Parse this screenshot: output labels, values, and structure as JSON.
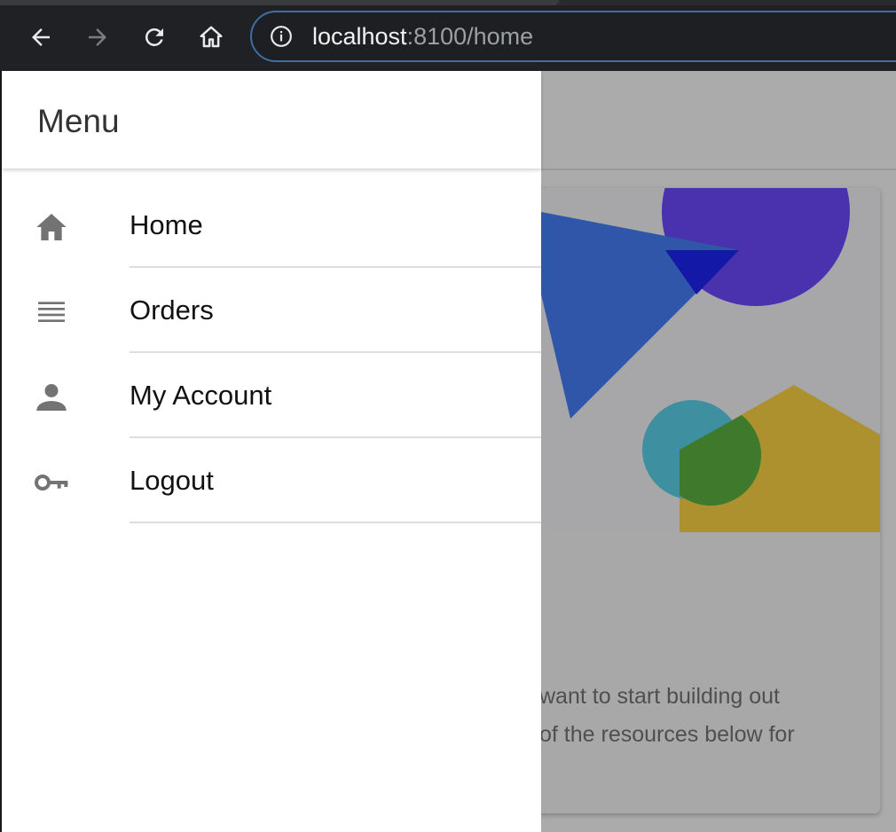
{
  "browser": {
    "url_host": "localhost",
    "url_rest": ":8100/home",
    "buttons": {
      "back": "back-arrow-icon",
      "forward": "forward-arrow-icon",
      "reload": "reload-icon",
      "home": "home-icon"
    },
    "accent_color": "#3b6fa8"
  },
  "menu": {
    "title": "Menu",
    "items": [
      {
        "label": "Home",
        "icon": "home-icon"
      },
      {
        "label": "Orders",
        "icon": "list-icon"
      },
      {
        "label": "My Account",
        "icon": "person-icon"
      },
      {
        "label": "Logout",
        "icon": "key-icon"
      }
    ]
  },
  "background_page": {
    "text_line_1": "want to start building out",
    "text_line_2": "of the resources below for"
  }
}
